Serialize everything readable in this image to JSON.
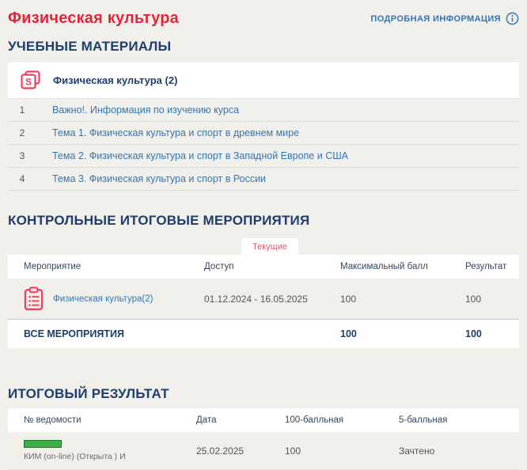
{
  "page": {
    "title": "Физическая культура",
    "header_link": "ПОДРОБНАЯ ИНФОРМАЦИЯ"
  },
  "colors": {
    "accent_red": "#e2243f",
    "heading_navy": "#1d3e6e",
    "link_blue": "#3576b0",
    "icon_pink": "#ef3f5e",
    "tab_pink": "#e0556a",
    "green_bar": "#3fae49",
    "page_bg": "#f0efea"
  },
  "materials": {
    "heading": "УЧЕБНЫЕ МАТЕРИАЛЫ",
    "course": {
      "label": "Физическая культура (2)",
      "icon_letter": "S"
    },
    "items": [
      {
        "num": "1",
        "label": "Важно!. Информация по изучению курса"
      },
      {
        "num": "2",
        "label": "Тема 1. Физическая культура и спорт в древнем мире"
      },
      {
        "num": "3",
        "label": "Тема 2. Физическая культура и спорт в Западной Европе и США"
      },
      {
        "num": "4",
        "label": "Тема 3. Физическая культура и спорт в России"
      }
    ]
  },
  "control_events": {
    "heading": "КОНТРОЛЬНЫЕ ИТОГОВЫЕ МЕРОПРИЯТИЯ",
    "tab": "Текущие",
    "columns": [
      "Мероприятие",
      "Доступ",
      "Максимальный балл",
      "Результат"
    ],
    "rows": [
      {
        "name": "Физическая культура(2)",
        "access": "01.12.2024 - 16.05.2025",
        "max_score": "100",
        "result": "100"
      }
    ],
    "footer": {
      "label": "ВСЕ МЕРОПРИЯТИЯ",
      "max_score": "100",
      "result": "100"
    }
  },
  "final_result": {
    "heading": "ИТОГОВЫЙ РЕЗУЛЬТАТ",
    "columns": [
      "№ ведомости",
      "Дата",
      "100-балльная",
      "5-балльная"
    ],
    "rows": [
      {
        "name": "КИМ (on-line) (Открыта ) И",
        "date": "25.02.2025",
        "score100": "100",
        "score5": "Зачтено"
      }
    ]
  }
}
